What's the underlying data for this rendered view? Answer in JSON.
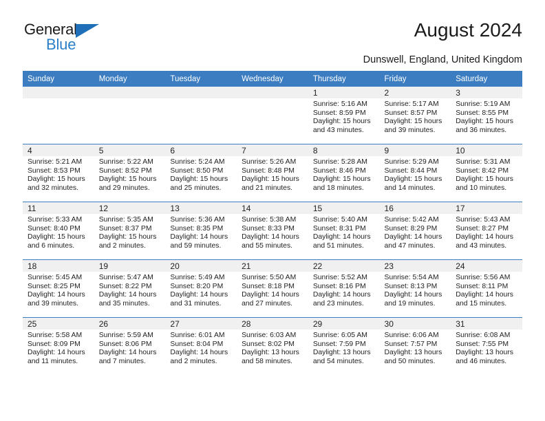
{
  "brand": {
    "name_part1": "General",
    "name_part2": "Blue",
    "triangle_icon": "triangle-logo-icon",
    "color_dark": "#1b1b1b",
    "color_blue": "#2a7fc9"
  },
  "header": {
    "title": "August 2024",
    "subtitle": "Dunswell, England, United Kingdom"
  },
  "theme": {
    "header_bg": "#3b7dc0",
    "header_text": "#ffffff",
    "daynum_bg": "#f0f0f0",
    "body_text": "#222222"
  },
  "weekdays": [
    "Sunday",
    "Monday",
    "Tuesday",
    "Wednesday",
    "Thursday",
    "Friday",
    "Saturday"
  ],
  "labels": {
    "sunrise_prefix": "Sunrise: ",
    "sunset_prefix": "Sunset: ",
    "daylight_prefix": "Daylight: "
  },
  "weeks": [
    [
      {
        "day": "",
        "empty": true
      },
      {
        "day": "",
        "empty": true
      },
      {
        "day": "",
        "empty": true
      },
      {
        "day": "",
        "empty": true
      },
      {
        "day": "1",
        "sunrise": "Sunrise: 5:16 AM",
        "sunset": "Sunset: 8:59 PM",
        "daylight": "Daylight: 15 hours and 43 minutes."
      },
      {
        "day": "2",
        "sunrise": "Sunrise: 5:17 AM",
        "sunset": "Sunset: 8:57 PM",
        "daylight": "Daylight: 15 hours and 39 minutes."
      },
      {
        "day": "3",
        "sunrise": "Sunrise: 5:19 AM",
        "sunset": "Sunset: 8:55 PM",
        "daylight": "Daylight: 15 hours and 36 minutes."
      }
    ],
    [
      {
        "day": "4",
        "sunrise": "Sunrise: 5:21 AM",
        "sunset": "Sunset: 8:53 PM",
        "daylight": "Daylight: 15 hours and 32 minutes."
      },
      {
        "day": "5",
        "sunrise": "Sunrise: 5:22 AM",
        "sunset": "Sunset: 8:52 PM",
        "daylight": "Daylight: 15 hours and 29 minutes."
      },
      {
        "day": "6",
        "sunrise": "Sunrise: 5:24 AM",
        "sunset": "Sunset: 8:50 PM",
        "daylight": "Daylight: 15 hours and 25 minutes."
      },
      {
        "day": "7",
        "sunrise": "Sunrise: 5:26 AM",
        "sunset": "Sunset: 8:48 PM",
        "daylight": "Daylight: 15 hours and 21 minutes."
      },
      {
        "day": "8",
        "sunrise": "Sunrise: 5:28 AM",
        "sunset": "Sunset: 8:46 PM",
        "daylight": "Daylight: 15 hours and 18 minutes."
      },
      {
        "day": "9",
        "sunrise": "Sunrise: 5:29 AM",
        "sunset": "Sunset: 8:44 PM",
        "daylight": "Daylight: 15 hours and 14 minutes."
      },
      {
        "day": "10",
        "sunrise": "Sunrise: 5:31 AM",
        "sunset": "Sunset: 8:42 PM",
        "daylight": "Daylight: 15 hours and 10 minutes."
      }
    ],
    [
      {
        "day": "11",
        "sunrise": "Sunrise: 5:33 AM",
        "sunset": "Sunset: 8:40 PM",
        "daylight": "Daylight: 15 hours and 6 minutes."
      },
      {
        "day": "12",
        "sunrise": "Sunrise: 5:35 AM",
        "sunset": "Sunset: 8:37 PM",
        "daylight": "Daylight: 15 hours and 2 minutes."
      },
      {
        "day": "13",
        "sunrise": "Sunrise: 5:36 AM",
        "sunset": "Sunset: 8:35 PM",
        "daylight": "Daylight: 14 hours and 59 minutes."
      },
      {
        "day": "14",
        "sunrise": "Sunrise: 5:38 AM",
        "sunset": "Sunset: 8:33 PM",
        "daylight": "Daylight: 14 hours and 55 minutes."
      },
      {
        "day": "15",
        "sunrise": "Sunrise: 5:40 AM",
        "sunset": "Sunset: 8:31 PM",
        "daylight": "Daylight: 14 hours and 51 minutes."
      },
      {
        "day": "16",
        "sunrise": "Sunrise: 5:42 AM",
        "sunset": "Sunset: 8:29 PM",
        "daylight": "Daylight: 14 hours and 47 minutes."
      },
      {
        "day": "17",
        "sunrise": "Sunrise: 5:43 AM",
        "sunset": "Sunset: 8:27 PM",
        "daylight": "Daylight: 14 hours and 43 minutes."
      }
    ],
    [
      {
        "day": "18",
        "sunrise": "Sunrise: 5:45 AM",
        "sunset": "Sunset: 8:25 PM",
        "daylight": "Daylight: 14 hours and 39 minutes."
      },
      {
        "day": "19",
        "sunrise": "Sunrise: 5:47 AM",
        "sunset": "Sunset: 8:22 PM",
        "daylight": "Daylight: 14 hours and 35 minutes."
      },
      {
        "day": "20",
        "sunrise": "Sunrise: 5:49 AM",
        "sunset": "Sunset: 8:20 PM",
        "daylight": "Daylight: 14 hours and 31 minutes."
      },
      {
        "day": "21",
        "sunrise": "Sunrise: 5:50 AM",
        "sunset": "Sunset: 8:18 PM",
        "daylight": "Daylight: 14 hours and 27 minutes."
      },
      {
        "day": "22",
        "sunrise": "Sunrise: 5:52 AM",
        "sunset": "Sunset: 8:16 PM",
        "daylight": "Daylight: 14 hours and 23 minutes."
      },
      {
        "day": "23",
        "sunrise": "Sunrise: 5:54 AM",
        "sunset": "Sunset: 8:13 PM",
        "daylight": "Daylight: 14 hours and 19 minutes."
      },
      {
        "day": "24",
        "sunrise": "Sunrise: 5:56 AM",
        "sunset": "Sunset: 8:11 PM",
        "daylight": "Daylight: 14 hours and 15 minutes."
      }
    ],
    [
      {
        "day": "25",
        "sunrise": "Sunrise: 5:58 AM",
        "sunset": "Sunset: 8:09 PM",
        "daylight": "Daylight: 14 hours and 11 minutes."
      },
      {
        "day": "26",
        "sunrise": "Sunrise: 5:59 AM",
        "sunset": "Sunset: 8:06 PM",
        "daylight": "Daylight: 14 hours and 7 minutes."
      },
      {
        "day": "27",
        "sunrise": "Sunrise: 6:01 AM",
        "sunset": "Sunset: 8:04 PM",
        "daylight": "Daylight: 14 hours and 2 minutes."
      },
      {
        "day": "28",
        "sunrise": "Sunrise: 6:03 AM",
        "sunset": "Sunset: 8:02 PM",
        "daylight": "Daylight: 13 hours and 58 minutes."
      },
      {
        "day": "29",
        "sunrise": "Sunrise: 6:05 AM",
        "sunset": "Sunset: 7:59 PM",
        "daylight": "Daylight: 13 hours and 54 minutes."
      },
      {
        "day": "30",
        "sunrise": "Sunrise: 6:06 AM",
        "sunset": "Sunset: 7:57 PM",
        "daylight": "Daylight: 13 hours and 50 minutes."
      },
      {
        "day": "31",
        "sunrise": "Sunrise: 6:08 AM",
        "sunset": "Sunset: 7:55 PM",
        "daylight": "Daylight: 13 hours and 46 minutes."
      }
    ]
  ]
}
